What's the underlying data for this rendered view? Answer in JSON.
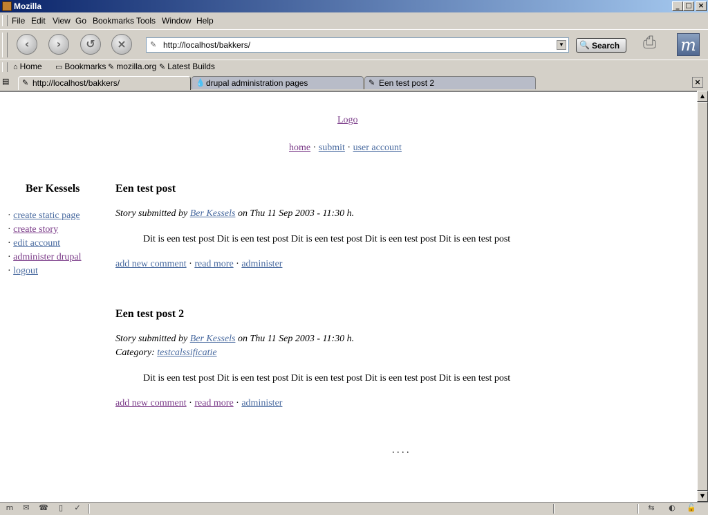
{
  "window": {
    "title": "Mozilla",
    "minimize": "_",
    "maximize": "□",
    "close": "×"
  },
  "menu": [
    "File",
    "Edit",
    "View",
    "Go",
    "Bookmarks",
    "Tools",
    "Window",
    "Help"
  ],
  "nav": {
    "back_icon": "back-arrow-icon",
    "forward_icon": "forward-arrow-icon",
    "reload_icon": "reload-icon",
    "stop_icon": "stop-icon"
  },
  "url": "http://localhost/bakkers/",
  "search_label": "Search",
  "bookmarks": [
    "Home",
    "Bookmarks",
    "mozilla.org",
    "Latest Builds"
  ],
  "tabs": [
    {
      "label": "http://localhost/bakkers/",
      "active": true
    },
    {
      "label": "drupal administration pages",
      "active": false
    },
    {
      "label": "Een test post 2",
      "active": false
    }
  ],
  "page": {
    "logo": "Logo",
    "primary_links": [
      "home",
      "submit",
      "user account"
    ],
    "sidebar": {
      "title": "Ber Kessels",
      "links": [
        "create static page",
        "create story",
        "edit account",
        "administer drupal",
        "logout"
      ]
    },
    "posts": [
      {
        "title": "Een test post",
        "submitted_prefix": "Story submitted by",
        "author": "Ber Kessels",
        "submitted_suffix": "on Thu 11 Sep 2003 - 11:30 h.",
        "category_label": "",
        "category": "",
        "body": "Dit is een test post Dit is een test post Dit is een test post Dit is een test post Dit is een test post",
        "links": [
          "add new comment",
          "read more",
          "administer"
        ]
      },
      {
        "title": "Een test post 2",
        "submitted_prefix": "Story submitted by",
        "author": "Ber Kessels",
        "submitted_suffix": "on Thu 11 Sep 2003 - 11:30 h.",
        "category_label": "Category:",
        "category": "testcalssificatie",
        "body": "Dit is een test post Dit is een test post Dit is een test post Dit is een test post Dit is een test post",
        "links": [
          "add new comment",
          "read more",
          "administer"
        ]
      }
    ],
    "pager": ". . . ."
  },
  "separators": {
    "dot": "·"
  }
}
